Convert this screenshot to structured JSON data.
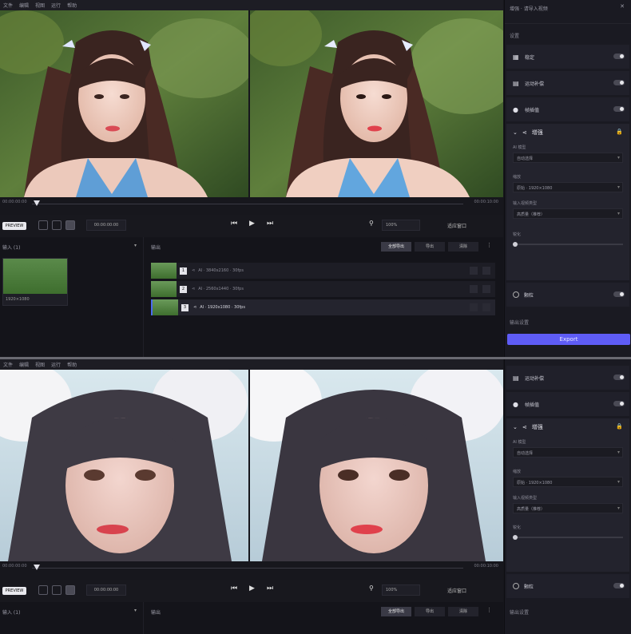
{
  "top": {
    "menu": [
      "文件",
      "编辑",
      "视图",
      "运行",
      "帮助"
    ],
    "side": {
      "header_hint": "增强 · 请导入视频",
      "section_label": "设置",
      "features": [
        {
          "label": "稳定",
          "icon": "stabilize-icon"
        },
        {
          "label": "运动补偿",
          "icon": "motion-icon"
        },
        {
          "label": "帧插值",
          "icon": "interpolate-icon"
        }
      ],
      "expanded": {
        "label": "增强",
        "fields": [
          {
            "label": "AI 模型",
            "value": "自动选择"
          },
          {
            "label": "缩放",
            "value": "原始 · 1920×1080"
          },
          {
            "label": "输入视频类型",
            "value": "高质量（推荐）"
          }
        ],
        "slider_label": "锐化"
      },
      "grain_label": "颗粒",
      "output_section": "输出设置",
      "export_label": "Export"
    },
    "timeline": {
      "start": "00:00:00:00",
      "end": "00:00:10:00"
    },
    "controls": {
      "badge": "PREVIEW",
      "time": "00:00:00:00",
      "zoom": "100%",
      "fit": "适应窗口"
    },
    "inputs": {
      "title": "输入 (1)",
      "meta": "1920×1080"
    },
    "outputs": {
      "title": "输出",
      "tabs": [
        "全部导出",
        "导出",
        "清除"
      ],
      "rows": [
        {
          "num": "1",
          "name": "AI · 3840x2160 · 30fps"
        },
        {
          "num": "2",
          "name": "AI · 2560x1440 · 30fps"
        },
        {
          "num": "3",
          "name": "AI · 1920x1080 · 30fps"
        }
      ]
    }
  },
  "bottom": {
    "menu": [
      "文件",
      "编辑",
      "视图",
      "运行",
      "帮助"
    ],
    "side": {
      "features": [
        {
          "label": "运动补偿",
          "icon": "motion-icon"
        },
        {
          "label": "帧插值",
          "icon": "interpolate-icon"
        }
      ],
      "expanded": {
        "label": "增强",
        "fields": [
          {
            "label": "AI 模型",
            "value": "自动选择"
          },
          {
            "label": "缩放",
            "value": "原始 · 1920×1080"
          },
          {
            "label": "输入视频类型",
            "value": "高质量（推荐）"
          }
        ],
        "slider_label": "锐化"
      },
      "grain_label": "颗粒",
      "output_section": "输出设置"
    },
    "timeline": {
      "start": "00:00:00:00",
      "end": "00:00:10:00"
    },
    "controls": {
      "badge": "PREVIEW",
      "time": "00:00:00:00",
      "zoom": "100%",
      "fit": "适应窗口"
    },
    "inputs": {
      "title": "输入 (1)"
    },
    "outputs": {
      "title": "输出",
      "tabs": [
        "全部导出",
        "导出",
        "清除"
      ]
    }
  }
}
